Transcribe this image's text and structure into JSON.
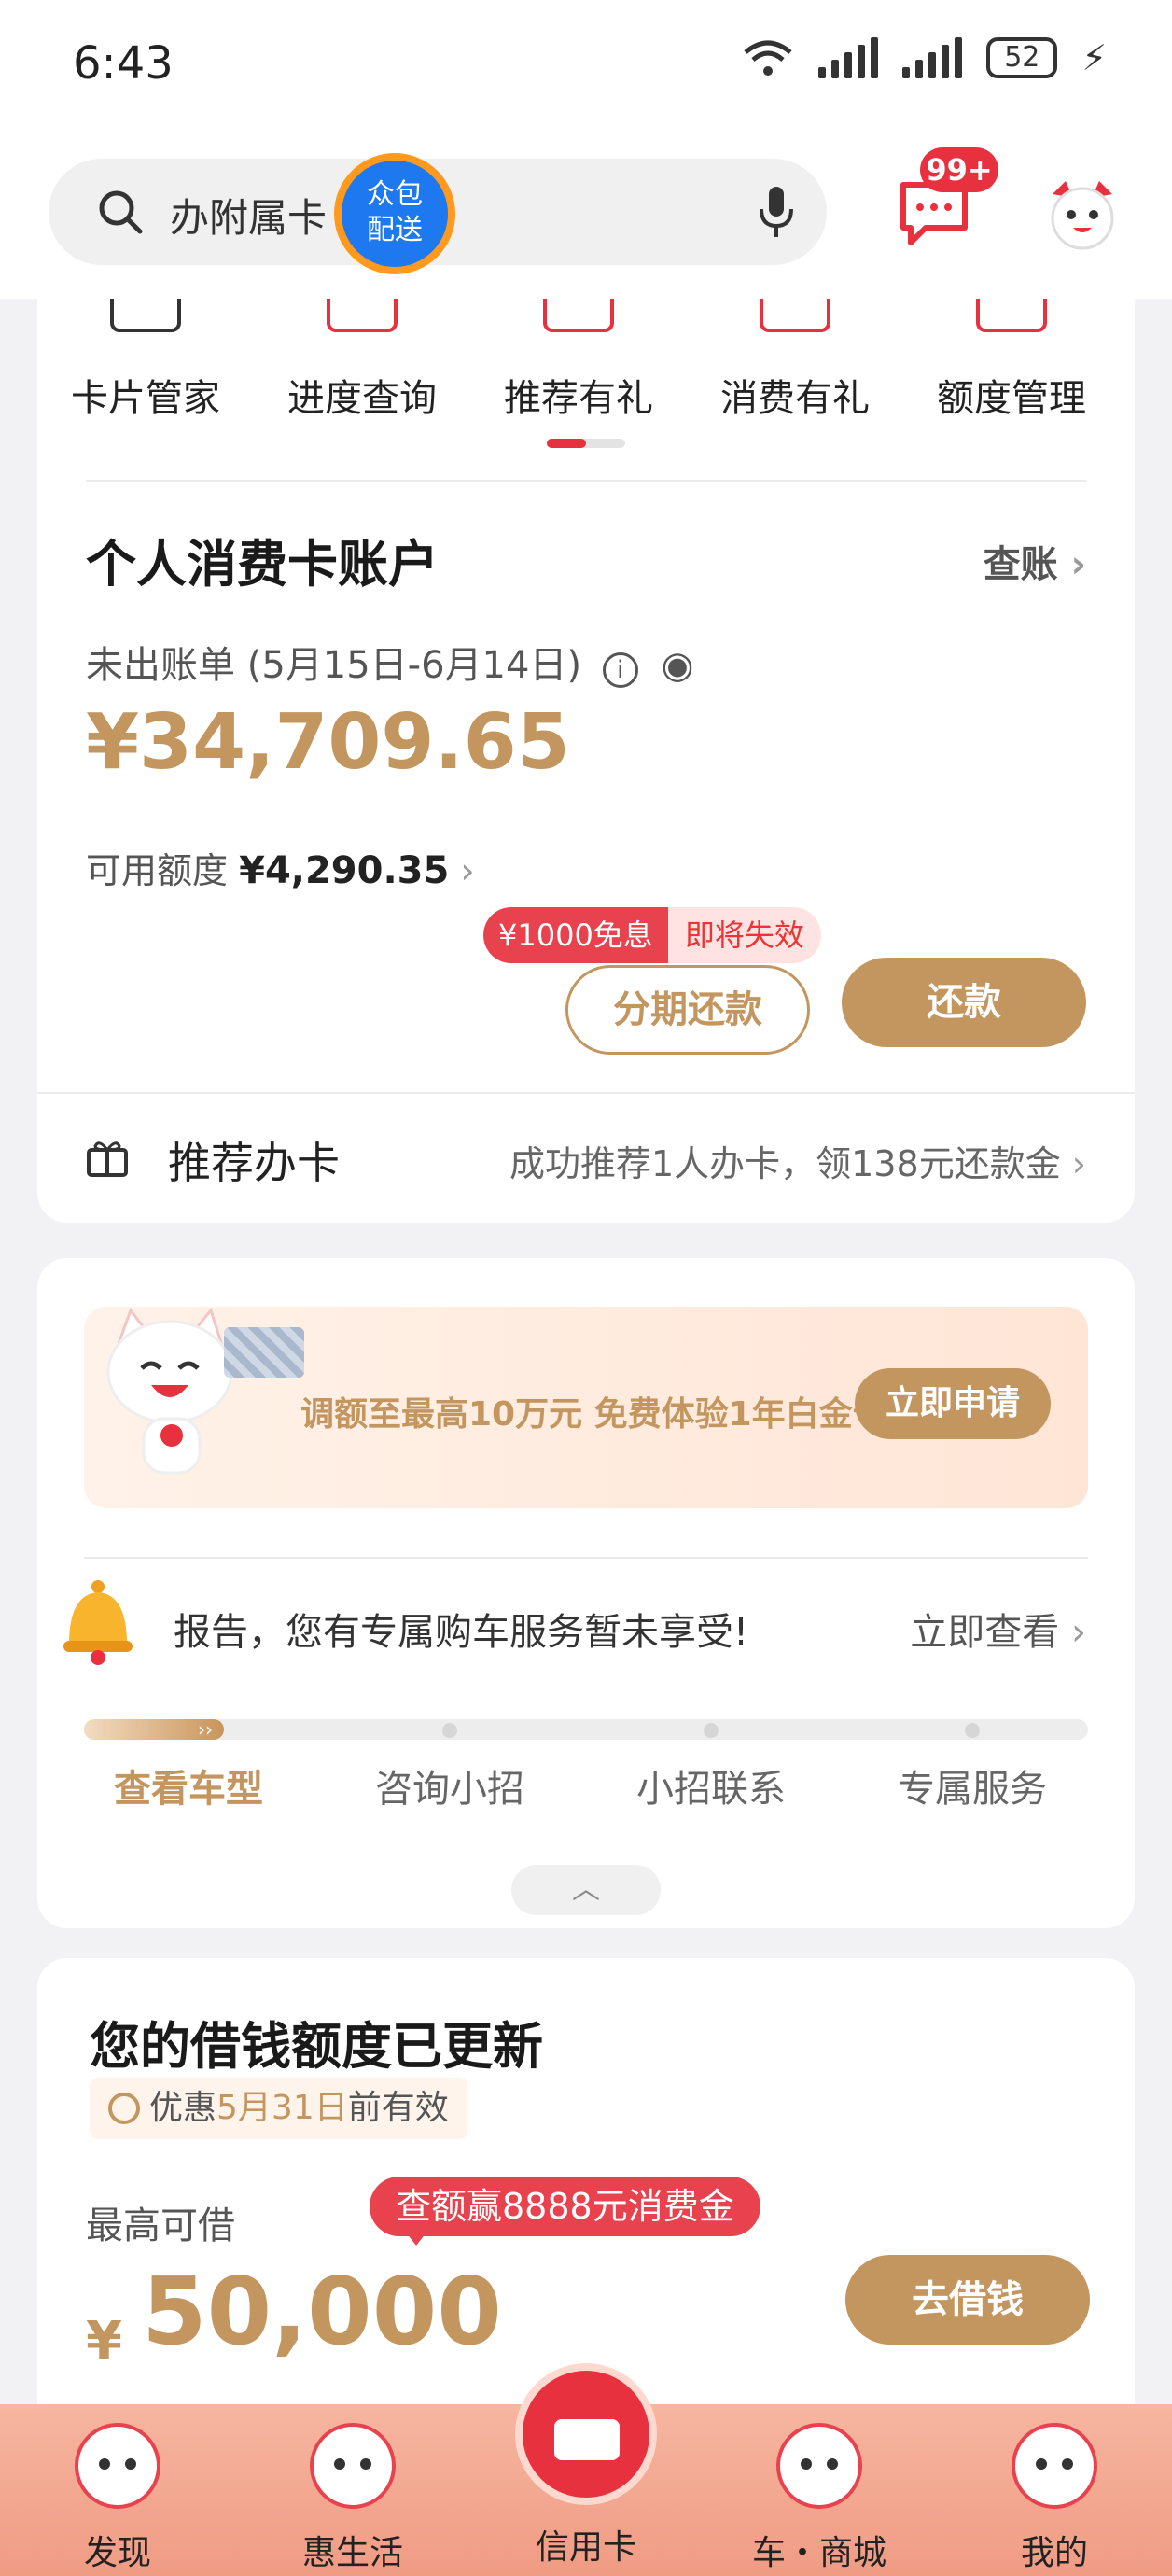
{
  "status_bar": {
    "time": "6:43",
    "battery": "52"
  },
  "header": {
    "search_text": "办附属卡",
    "floating_badge": "众包\n配送",
    "message_badge": "99+"
  },
  "quick_menu": [
    {
      "label": "卡片管家"
    },
    {
      "label": "进度查询"
    },
    {
      "label": "推荐有礼"
    },
    {
      "label": "消费有礼"
    },
    {
      "label": "额度管理"
    }
  ],
  "account": {
    "title": "个人消费卡账户",
    "view_bill": "查账",
    "bill_label": "未出账单 (5月15日-6月14日)",
    "amount": "¥34,709.65",
    "limit_label": "可用额度",
    "limit_value": "¥4,290.35",
    "promo_free": "¥1000免息",
    "promo_expire": "即将失效",
    "installment_button": "分期还款",
    "repay_button": "还款",
    "refer_label": "推荐办卡",
    "refer_text": "成功推荐1人办卡，领138元还款金"
  },
  "promo_card": {
    "banner_text": "调额至最高10万元 免费体验1年白金卡",
    "banner_button": "立即申请",
    "notice_text": "报告，您有专属购车服务暂未享受!",
    "notice_link": "立即查看",
    "steps": [
      "查看车型",
      "咨询小招",
      "小招联系",
      "专属服务"
    ]
  },
  "loan": {
    "title": "您的借钱额度已更新",
    "valid_prefix": "优惠",
    "valid_date": "5月31日",
    "valid_suffix": "前有效",
    "max_label": "最高可借",
    "tip": "查额赢8888元消费金",
    "currency": "¥",
    "amount": "50,000",
    "button": "去借钱"
  },
  "bottom_nav": [
    {
      "label": "发现"
    },
    {
      "label": "惠生活"
    },
    {
      "label": "信用卡"
    },
    {
      "label": "车・商城"
    },
    {
      "label": "我的"
    }
  ],
  "colors": {
    "accent": "#c4965f",
    "red": "#e8313f"
  }
}
